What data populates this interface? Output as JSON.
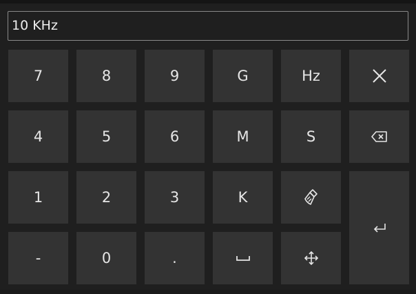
{
  "input": {
    "value": "10 KHz"
  },
  "keys": {
    "k7": "7",
    "k8": "8",
    "k9": "9",
    "G": "G",
    "Hz": "Hz",
    "k4": "4",
    "k5": "5",
    "k6": "6",
    "M": "M",
    "S": "S",
    "k1": "1",
    "k2": "2",
    "k3": "3",
    "K": "K",
    "minus": "-",
    "k0": "0",
    "dot": "."
  },
  "icons": {
    "close": "close-icon",
    "backspace": "backspace-icon",
    "clear": "broom-icon",
    "enter": "enter-icon",
    "space": "space-icon",
    "move": "move-icon"
  },
  "colors": {
    "background": "#1f1f1f",
    "key": "#333333",
    "text": "#e6e6e6",
    "input_border": "#8a8a8a"
  }
}
